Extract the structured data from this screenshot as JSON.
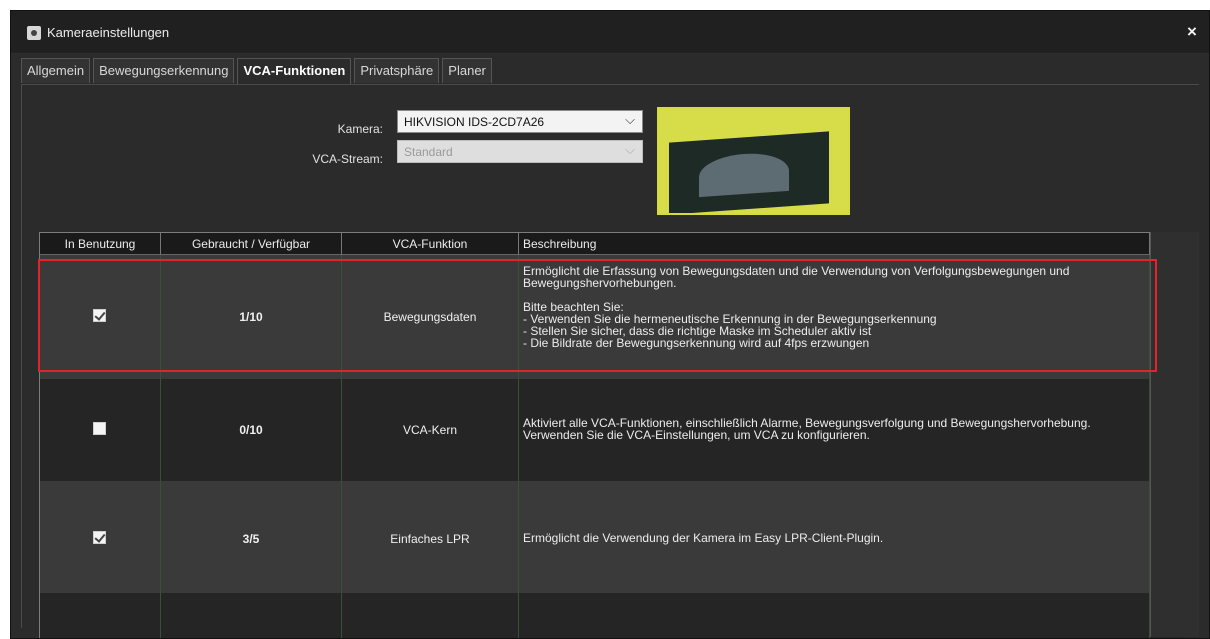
{
  "window": {
    "title": "Kameraeinstellungen",
    "close_label": "×",
    "icon": "camera-settings-icon"
  },
  "tabs": [
    {
      "label": "Allgemein",
      "active": false
    },
    {
      "label": "Bewegungserkennung",
      "active": false
    },
    {
      "label": "VCA-Funktionen",
      "active": true
    },
    {
      "label": "Privatsphäre",
      "active": false
    },
    {
      "label": "Planer",
      "active": false
    }
  ],
  "form": {
    "camera_label": "Kamera:",
    "camera_value": "HIKVISION IDS-2CD7A26",
    "stream_label": "VCA-Stream:",
    "stream_value": "Standard"
  },
  "table": {
    "headers": [
      "In Benutzung",
      "Gebraucht / Verfügbar",
      "VCA-Funktion",
      "Beschreibung"
    ],
    "rows": [
      {
        "in_use": true,
        "count": "1/10",
        "function": "Bewegungsdaten",
        "description": [
          "Ermöglicht die Erfassung von Bewegungsdaten und die Verwendung von Verfolgungsbewegungen und",
          "Bewegungshervorhebungen.",
          "",
          "Bitte beachten Sie:",
          "- Verwenden Sie die hermeneutische Erkennung in der Bewegungserkennung",
          "- Stellen Sie sicher, dass die richtige Maske im Scheduler aktiv ist",
          "- Die Bildrate der Bewegungserkennung wird auf 4fps erzwungen"
        ]
      },
      {
        "in_use": false,
        "count": "0/10",
        "function": "VCA-Kern",
        "description": [
          "Aktiviert alle VCA-Funktionen, einschließlich Alarme, Bewegungsverfolgung und Bewegungshervorhebung.",
          "Verwenden Sie die VCA-Einstellungen, um VCA zu konfigurieren."
        ]
      },
      {
        "in_use": true,
        "count": "3/5",
        "function": "Einfaches LPR",
        "description": [
          "Ermöglicht die Verwendung der Kamera im Easy LPR-Client-Plugin."
        ]
      }
    ]
  },
  "colors": {
    "highlight": "#e3232c",
    "preview_border": "#d6dc3c",
    "background": "#2b2b2b"
  }
}
